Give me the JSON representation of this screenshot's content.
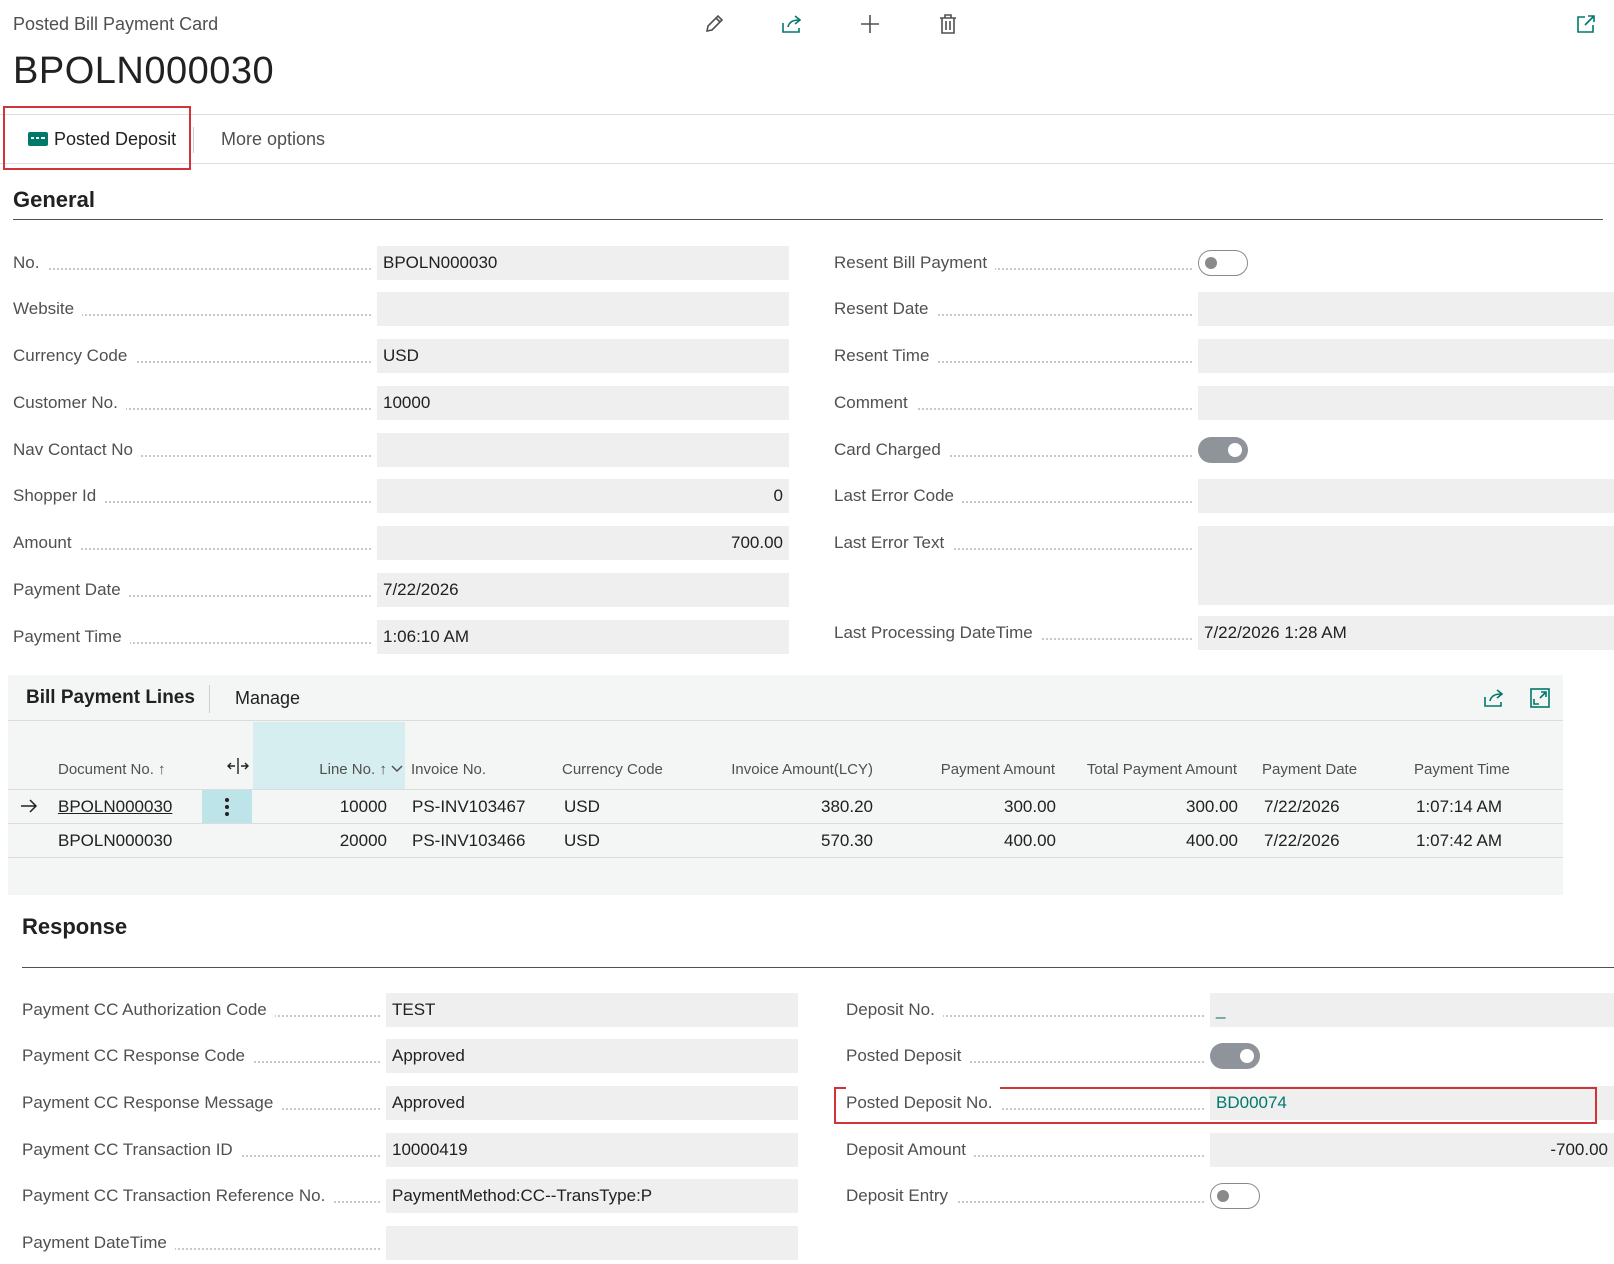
{
  "header": {
    "caption": "Posted Bill Payment Card",
    "title": "BPOLN000030"
  },
  "actions": {
    "posted_deposit": "Posted Deposit",
    "more_options": "More options"
  },
  "general": {
    "title": "General",
    "left": [
      {
        "label": "No.",
        "value": "BPOLN000030",
        "align": "left"
      },
      {
        "label": "Website",
        "value": "",
        "align": "left"
      },
      {
        "label": "Currency Code",
        "value": "USD",
        "align": "left"
      },
      {
        "label": "Customer No.",
        "value": "10000",
        "align": "left"
      },
      {
        "label": "Nav Contact No",
        "value": "",
        "align": "left"
      },
      {
        "label": "Shopper Id",
        "value": "0",
        "align": "right"
      },
      {
        "label": "Amount",
        "value": "700.00",
        "align": "right"
      },
      {
        "label": "Payment Date",
        "value": "7/22/2026",
        "align": "left"
      },
      {
        "label": "Payment Time",
        "value": "1:06:10 AM",
        "align": "left"
      }
    ],
    "resent_bill_payment": {
      "label": "Resent Bill Payment",
      "state": "off"
    },
    "resent_date": {
      "label": "Resent Date",
      "value": ""
    },
    "resent_time": {
      "label": "Resent Time",
      "value": ""
    },
    "comment": {
      "label": "Comment",
      "value": ""
    },
    "card_charged": {
      "label": "Card Charged",
      "state": "on"
    },
    "last_error_code": {
      "label": "Last Error Code",
      "value": ""
    },
    "last_error_text": {
      "label": "Last Error Text",
      "value": ""
    },
    "last_processing": {
      "label": "Last Processing DateTime",
      "value": "7/22/2026 1:28 AM"
    }
  },
  "lines": {
    "title": "Bill Payment Lines",
    "manage": "Manage",
    "columns": {
      "document_no": "Document No. ↑",
      "line_no": "Line No. ↑",
      "invoice_no": "Invoice No.",
      "currency_code": "Currency Code",
      "invoice_amount": "Invoice Amount(LCY)",
      "payment_amount": "Payment Amount",
      "total_payment_amount": "Total Payment Amount",
      "payment_date": "Payment Date",
      "payment_time": "Payment Time"
    },
    "rows": [
      {
        "document_no": "BPOLN000030",
        "line_no": "10000",
        "invoice_no": "PS-INV103467",
        "currency_code": "USD",
        "invoice_amount": "380.20",
        "payment_amount": "300.00",
        "total_payment_amount": "300.00",
        "payment_date": "7/22/2026",
        "payment_time": "1:07:14 AM"
      },
      {
        "document_no": "BPOLN000030",
        "line_no": "20000",
        "invoice_no": "PS-INV103466",
        "currency_code": "USD",
        "invoice_amount": "570.30",
        "payment_amount": "400.00",
        "total_payment_amount": "400.00",
        "payment_date": "7/22/2026",
        "payment_time": "1:07:42 AM"
      }
    ]
  },
  "response": {
    "title": "Response",
    "left": [
      {
        "label": "Payment CC Authorization Code",
        "value": "TEST"
      },
      {
        "label": "Payment CC Response Code",
        "value": "Approved"
      },
      {
        "label": "Payment CC Response Message",
        "value": "Approved"
      },
      {
        "label": "Payment CC Transaction ID",
        "value": "10000419"
      },
      {
        "label": "Payment CC Transaction Reference No.",
        "value": "PaymentMethod:CC--TransType:P"
      },
      {
        "label": "Payment DateTime",
        "value": ""
      }
    ],
    "deposit_no": {
      "label": "Deposit No.",
      "value": "_"
    },
    "posted_deposit": {
      "label": "Posted Deposit",
      "state": "on"
    },
    "posted_deposit_no": {
      "label": "Posted Deposit No.",
      "value": "BD00074"
    },
    "deposit_amount": {
      "label": "Deposit Amount",
      "value": "-700.00"
    },
    "deposit_entry": {
      "label": "Deposit Entry",
      "state": "off"
    }
  },
  "colors": {
    "accent": "#00796b",
    "highlight": "#d13438",
    "toggle_on": "#8f949a"
  }
}
